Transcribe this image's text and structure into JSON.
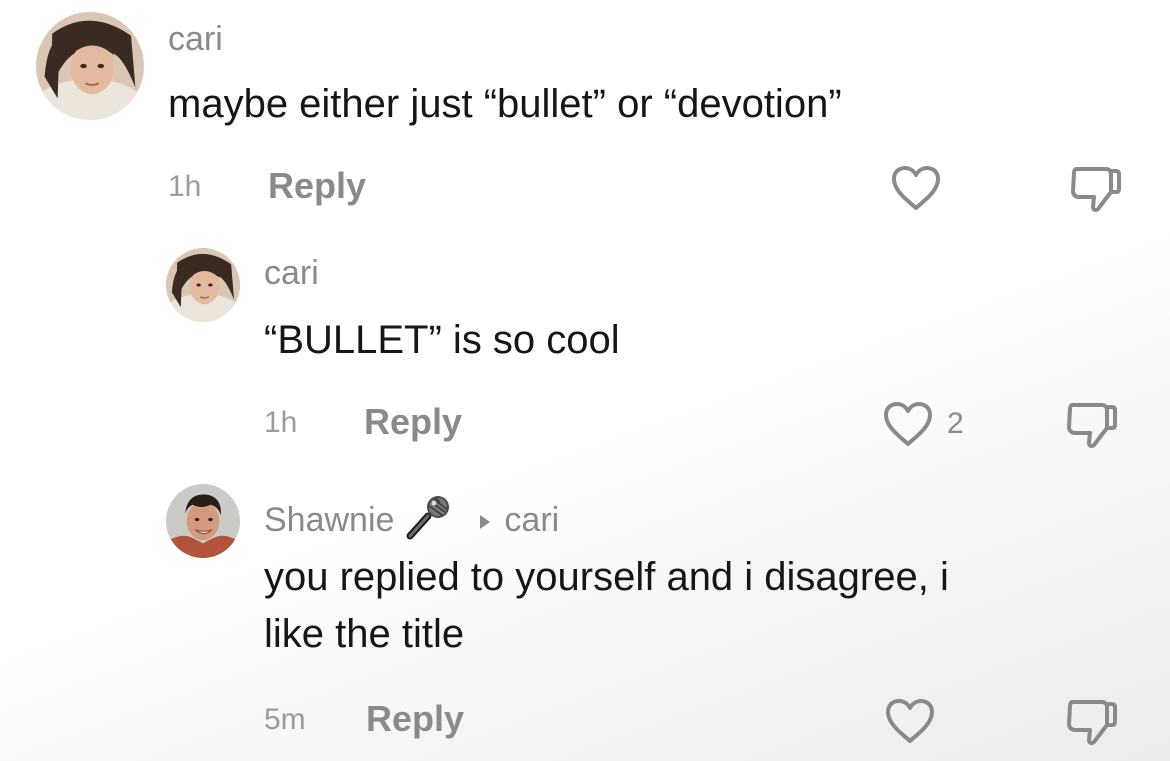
{
  "comments": [
    {
      "username": "cari",
      "text": "maybe either just “bullet” or “devotion”",
      "time": "1h",
      "reply_label": "Reply",
      "likes": ""
    },
    {
      "username": "cari",
      "text": "“BULLET” is so cool",
      "time": "1h",
      "reply_label": "Reply",
      "likes": "2"
    },
    {
      "username": "Shawnie",
      "reply_to": "cari",
      "text_line1": "you replied to yourself and i disagree, i",
      "text_line2": "like the title",
      "time": "5m",
      "reply_label": "Reply",
      "likes": ""
    }
  ],
  "icons": {
    "like": "heart-outline-icon",
    "dislike": "thumbs-down-outline-icon",
    "badge": "microphone-icon",
    "reply_arrow": "right-triangle-icon"
  },
  "colors": {
    "text": "#161616",
    "muted": "#8a8a8a",
    "icon": "#8a8a8a"
  }
}
